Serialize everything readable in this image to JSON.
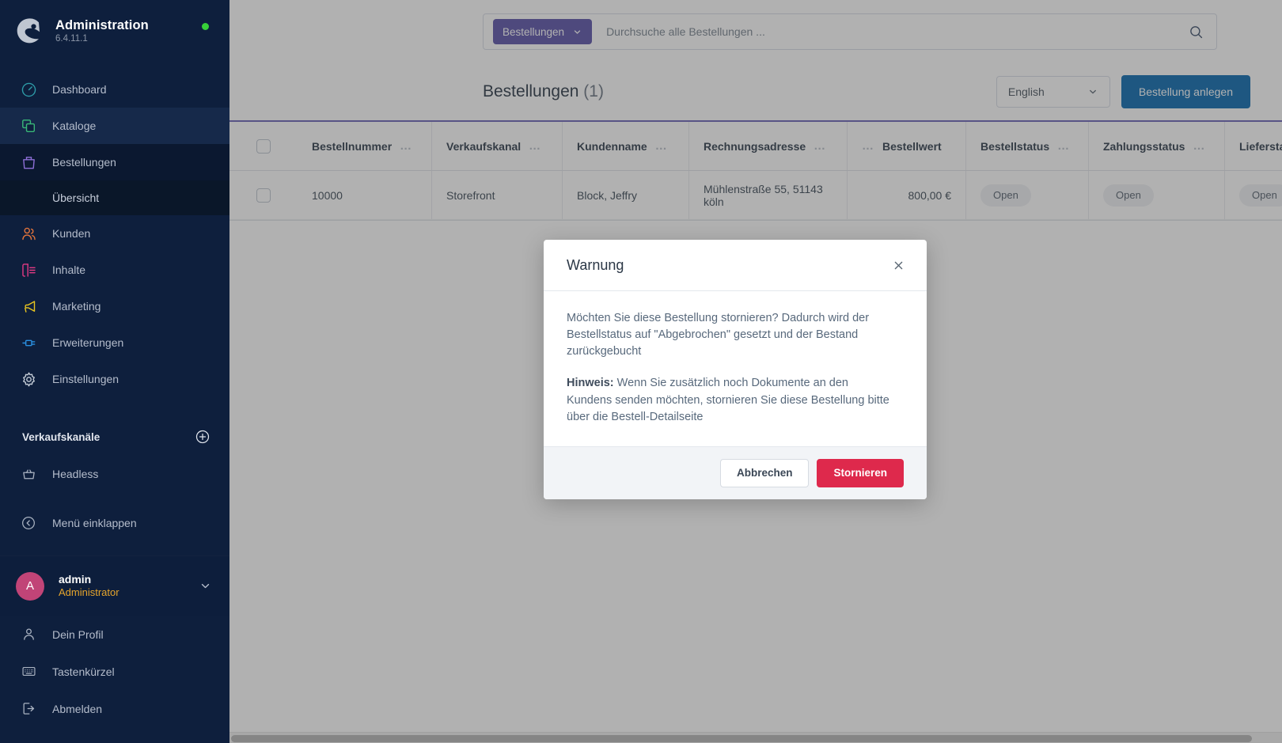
{
  "sidebar": {
    "brand": {
      "title": "Administration",
      "version": "6.4.11.1",
      "logo_icon": "shopware-logo-icon",
      "status_dot": "online-status-dot"
    },
    "items": [
      {
        "label": "Dashboard",
        "icon": "dashboard-icon",
        "color": "#2e9ba8"
      },
      {
        "label": "Kataloge",
        "icon": "catalog-icon",
        "color": "#39b878"
      },
      {
        "label": "Bestellungen",
        "icon": "orders-bag-icon",
        "color": "#8d6fd6"
      },
      {
        "label": "Kunden",
        "icon": "customers-icon",
        "color": "#e0733c"
      },
      {
        "label": "Inhalte",
        "icon": "content-icon",
        "color": "#e23a84"
      },
      {
        "label": "Marketing",
        "icon": "megaphone-icon",
        "color": "#e8c520"
      },
      {
        "label": "Erweiterungen",
        "icon": "plug-icon",
        "color": "#2a8fe0"
      },
      {
        "label": "Einstellungen",
        "icon": "gear-icon",
        "color": "#c3cbd6"
      }
    ],
    "sub_item": {
      "label": "Übersicht"
    },
    "section": {
      "label": "Verkaufskanäle",
      "add_icon": "plus-circle-icon"
    },
    "channels": [
      {
        "label": "Headless",
        "icon": "headless-basket-icon"
      }
    ],
    "collapse": {
      "label": "Menü einklappen",
      "icon": "collapse-left-icon"
    },
    "user": {
      "initial": "A",
      "name": "admin",
      "role": "Administrator",
      "chevron_icon": "chevron-down-icon"
    },
    "footer_items": [
      {
        "label": "Dein Profil",
        "icon": "user-icon"
      },
      {
        "label": "Tastenkürzel",
        "icon": "keyboard-icon"
      },
      {
        "label": "Abmelden",
        "icon": "logout-icon"
      }
    ]
  },
  "search": {
    "scope_label": "Bestellungen",
    "scope_chevron_icon": "chevron-down-icon",
    "placeholder": "Durchsuche alle Bestellungen ...",
    "value": "",
    "submit_icon": "search-icon"
  },
  "header": {
    "title": "Bestellungen",
    "count": "(1)",
    "language": {
      "value": "English",
      "chevron_icon": "chevron-down-icon"
    },
    "create_button": "Bestellung anlegen"
  },
  "table": {
    "columns": [
      {
        "key": "select",
        "label": ""
      },
      {
        "key": "number",
        "label": "Bestellnummer",
        "dots": "…"
      },
      {
        "key": "channel",
        "label": "Verkaufskanal",
        "dots": "…"
      },
      {
        "key": "customer",
        "label": "Kundenname",
        "dots": "…"
      },
      {
        "key": "address",
        "label": "Rechnungsadresse",
        "dots": "…"
      },
      {
        "key": "value",
        "label": "Bestellwert",
        "dots": "…"
      },
      {
        "key": "ostatus",
        "label": "Bestellstatus",
        "dots": "…"
      },
      {
        "key": "pstatus",
        "label": "Zahlungsstatus",
        "dots": "…"
      },
      {
        "key": "dstatus",
        "label": "Lieferstatus",
        "dots": "…"
      }
    ],
    "rows": [
      {
        "number": "10000",
        "channel": "Storefront",
        "customer": "Block, Jeffry",
        "address": "Mühlenstraße 55, 51143 köln",
        "value": "800,00 €",
        "ostatus": "Open",
        "pstatus": "Open",
        "dstatus": "Open"
      }
    ]
  },
  "modal": {
    "title": "Warnung",
    "close_icon": "close-icon",
    "paragraph1": "Möchten Sie diese Bestellung stornieren? Dadurch wird der Bestellstatus auf \"Abgebrochen\" gesetzt und der Bestand zurückgebucht",
    "note_label": "Hinweis:",
    "note_text": " Wenn Sie zusätzlich noch Dokumente an den Kundens senden möchten, stornieren Sie diese Bestellung bitte über die Bestell-Detailseite",
    "cancel_button": "Abbrechen",
    "confirm_button": "Stornieren"
  },
  "colors": {
    "sidebar_bg": "#0e1f3d",
    "accent_purple": "#5a52a8",
    "primary_blue": "#0a6ab0",
    "danger_red": "#de294c",
    "grid_top_border": "#6b64b8",
    "online_green": "#37d039",
    "avatar_pink": "#c14477",
    "role_orange": "#e6a52c"
  }
}
